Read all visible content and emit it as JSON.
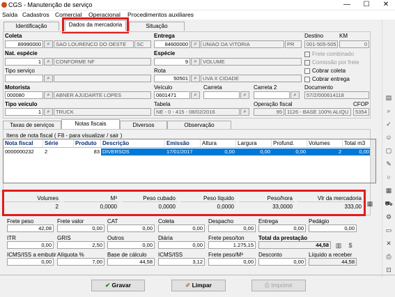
{
  "window": {
    "title": "CGS - Manutenção de serviço",
    "minimize": "—",
    "maximize": "☐",
    "close": "✕"
  },
  "menu": [
    "Saída",
    "Cadastros",
    "Comercial",
    "Operacional",
    "Procedimentos auxiliares"
  ],
  "tabs": [
    "Identificação",
    "Dados da mercadoria",
    "Situação"
  ],
  "form": {
    "coleta_label": "Coleta",
    "coleta_code": "89990000",
    "coleta_name": "SAO LOURENCO DO OESTE",
    "coleta_uf": "SC",
    "entrega_label": "Entrega",
    "entrega_code": "84600000",
    "entrega_name": "UNIAO DA VITORIA",
    "entrega_uf": "PR",
    "destino_label": "Destino",
    "destino_value": "001-505-505",
    "km_label": "KM",
    "km_value": "0",
    "nat_label": "Nat. espécie",
    "nat_code": "1",
    "nat_name": "CONFORME NF",
    "especie_label": "Espécie",
    "especie_code": "9",
    "especie_name": "VOLUME",
    "frete_combinado": "Frete combinado",
    "comissao_frete": "Comissão por frete",
    "tipo_servico_label": "Tipo serviço",
    "rota_label": "Rota",
    "rota_code": "50501",
    "rota_name": "UVA X CIDADE",
    "cobrar_coleta": "Cobrar coleta",
    "cobrar_entrega": "Cobrar entrega",
    "motorista_label": "Motorista",
    "motorista_code": "000080",
    "motorista_name": "ABNER AJUDARTE LOPES",
    "veiculo_label": "Veículo",
    "veiculo_value": "0601471",
    "carreta_label": "Carreta",
    "carreta2_label": "Carreta 2",
    "documento_label": "Documento",
    "documento_value": "57/2/000614118",
    "tipo_veiculo_label": "Tipo veículo",
    "tipo_veiculo_code": "1",
    "tipo_veiculo_name": "TRUCK",
    "tabela_label": "Tabela",
    "tabela_value": "NE - 0 - 415 - 08/02/2016",
    "opfiscal_label": "Operação fiscal",
    "opfiscal_code": "95",
    "opfiscal_name": "1126 - BASE 100% ALIQU",
    "cfop_label": "CFOP",
    "cfop_value": "5354"
  },
  "subtabs": [
    "Taxas de serviços",
    "Notas fiscais",
    "Diversos",
    "Observação"
  ],
  "items_caption": "Itens de nota fiscal ( F8 - para visualizar / sair )",
  "grid": {
    "headers": [
      "Nota fiscal",
      "Série",
      "Produto",
      "Descrição",
      "Emissão",
      "Altura",
      "Largura",
      "Profund.",
      "Volumes",
      "Total m3"
    ],
    "row": [
      "0000000232",
      "2",
      "83",
      "DIVERSOS",
      "17/01/2017",
      "0,00",
      "0,00",
      "0,00",
      "2",
      "0,00"
    ]
  },
  "summary": {
    "headers": [
      "Volumes",
      "M³",
      "Peso cubado",
      "Peso líquido",
      "Peso/hora",
      "Vlr da mercadoria"
    ],
    "values": [
      "2",
      "0,0000",
      "0,0000",
      "0,0000",
      "33,0000",
      "333,00"
    ]
  },
  "totals": {
    "row1_labels": [
      "Frete peso",
      "Frete valor",
      "CAT",
      "Coleta",
      "Despacho",
      "Entrega",
      "Pedágio"
    ],
    "row1_values": [
      "42,08",
      "0,00",
      "0,00",
      "0,00",
      "0,00",
      "0,00",
      "0,00"
    ],
    "row2_labels": [
      "ITR",
      "GRIS",
      "Outros",
      "Diária",
      "Frete peso/ton",
      "Total da prestação"
    ],
    "row2_values": [
      "0,00",
      "2,50",
      "0,00",
      "0,00",
      "1.275,15",
      "44,58"
    ],
    "row3_labels": [
      "ICMS/ISS a embutir",
      "Alíquota %",
      "Base de cálculo",
      "ICMS/ISS",
      "Frete peso/M³",
      "Desconto",
      "Líquido a receber"
    ],
    "row3_values": [
      "0,00",
      "7,00",
      "44,58",
      "3,12",
      "0,00",
      "0,00",
      "44,58"
    ]
  },
  "buttons": {
    "save": "Gravar",
    "clear": "Limpar",
    "print": "Imprimir"
  },
  "colors": {
    "selection": "#0078d7",
    "highlight": "#e21b1b",
    "header_text": "#0a2e7a"
  }
}
